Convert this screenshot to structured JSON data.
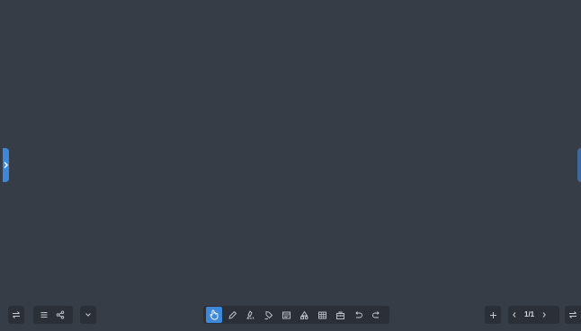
{
  "colors": {
    "canvas": "#373d46",
    "toolbar": "#2b3038",
    "accent": "#3e88d9",
    "icon": "#c6cbd3"
  },
  "left_controls": {
    "icons": [
      "swap-icon",
      "menu-icon",
      "share-icon",
      "chevron-down-icon"
    ]
  },
  "toolbar": {
    "active_tool": "select",
    "tools": [
      {
        "name": "select",
        "icon": "hand-pointer-icon"
      },
      {
        "name": "pen",
        "icon": "pen-icon"
      },
      {
        "name": "highlighter",
        "icon": "highlighter-icon"
      },
      {
        "name": "eraser",
        "icon": "eraser-icon"
      },
      {
        "name": "text",
        "icon": "text-box-icon"
      },
      {
        "name": "shapes",
        "icon": "shapes-icon"
      },
      {
        "name": "table",
        "icon": "table-icon"
      },
      {
        "name": "toolbox",
        "icon": "toolbox-icon"
      },
      {
        "name": "undo",
        "icon": "undo-icon"
      },
      {
        "name": "redo",
        "icon": "redo-icon"
      }
    ]
  },
  "pager": {
    "page_label": "1/1",
    "current_page": 1,
    "total_pages": 1
  },
  "right_controls": {
    "icons": [
      "add-page-icon",
      "prev-page-icon",
      "next-page-icon",
      "swap-icon"
    ]
  }
}
